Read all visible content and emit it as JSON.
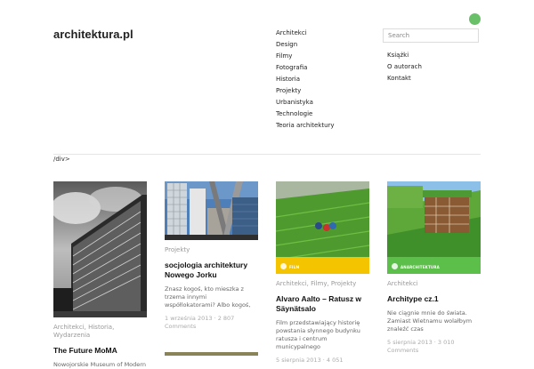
{
  "site": {
    "title": "architektura.pl"
  },
  "nav_primary": [
    "Architekci",
    "Design",
    "Filmy",
    "Fotografia",
    "Historia",
    "Projekty",
    "Urbanistyka",
    "Technologie",
    "Teoria architektury"
  ],
  "search": {
    "placeholder": "Search"
  },
  "nav_secondary": [
    "Książki",
    "O autorach",
    "Kontakt"
  ],
  "stray_text": "/div>",
  "colors": {
    "accent_dot": "#6abf69",
    "film_badge": "#f5c400",
    "arch_badge": "#5bbf4a"
  },
  "cards": [
    {
      "category": "Architekci, Historia, Wydarzenia",
      "title": "The Future MoMA",
      "excerpt": "Nowojorskie Museum of Modern",
      "date": ""
    },
    {
      "category": "Projekty",
      "title": "socjologia architektury Nowego Jorku",
      "excerpt": "Znasz kogoś, kto mieszka z trzema innymi współlokatorami? Albo kogoś,",
      "date": "1 września 2013 · 2 807 Comments"
    },
    {
      "category": "Architekci, Filmy, Projekty",
      "title": "Alvaro Aalto – Ratusz w Säynätsalo",
      "excerpt": "Film przedstawiający historię powstania słynnego budynku ratusza i centrum municypalnego",
      "date": "5 sierpnia 2013 · 4 051",
      "badge": "FILM"
    },
    {
      "category": "Architekci",
      "title": "Architype cz.1",
      "excerpt": "Nie ciągnie mnie do świata. Zamiast Wietnamu wolałbym znaleźć czas",
      "date": "5 sierpnia 2013 · 3 010 Comments",
      "badge": "ANARCHITEKTURA"
    }
  ]
}
